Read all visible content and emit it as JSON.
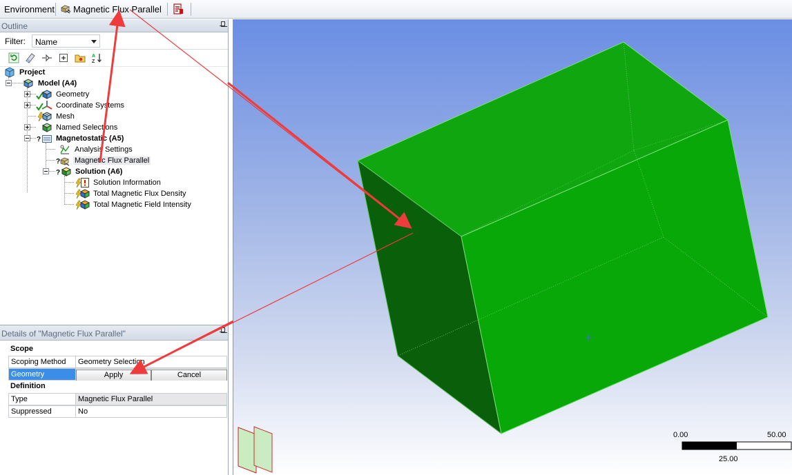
{
  "toolbar": {
    "environment_label": "Environment",
    "mfp_label": "Magnetic Flux Parallel"
  },
  "outline": {
    "title": "Outline",
    "filter_label": "Filter:",
    "filter_value": "Name",
    "tree": {
      "project": "Project",
      "model": "Model (A4)",
      "geometry": "Geometry",
      "coordinate_systems": "Coordinate Systems",
      "mesh": "Mesh",
      "named_selections": "Named Selections",
      "magnetostatic": "Magnetostatic (A5)",
      "analysis_settings": "Analysis Settings",
      "magnetic_flux_parallel": "Magnetic Flux Parallel",
      "solution": "Solution (A6)",
      "solution_information": "Solution Information",
      "total_flux_density": "Total Magnetic Flux Density",
      "total_field_intensity": "Total Magnetic Field Intensity"
    }
  },
  "details": {
    "title": "Details of \"Magnetic Flux Parallel\"",
    "scope_header": "Scope",
    "scoping_method_label": "Scoping Method",
    "scoping_method_value": "Geometry Selection",
    "geometry_label": "Geometry",
    "apply_label": "Apply",
    "cancel_label": "Cancel",
    "definition_header": "Definition",
    "type_label": "Type",
    "type_value": "Magnetic Flux Parallel",
    "suppressed_label": "Suppressed",
    "suppressed_value": "No"
  },
  "viewport": {
    "scale_left": "0.00",
    "scale_right": "50.00",
    "scale_mid": "25.00"
  },
  "colors": {
    "body_front": "#0aa80a",
    "body_top": "#11a511",
    "body_left": "#0b6a0b",
    "annotation_arrow": "#ee3b3b",
    "selection": "#3b8ee8"
  }
}
